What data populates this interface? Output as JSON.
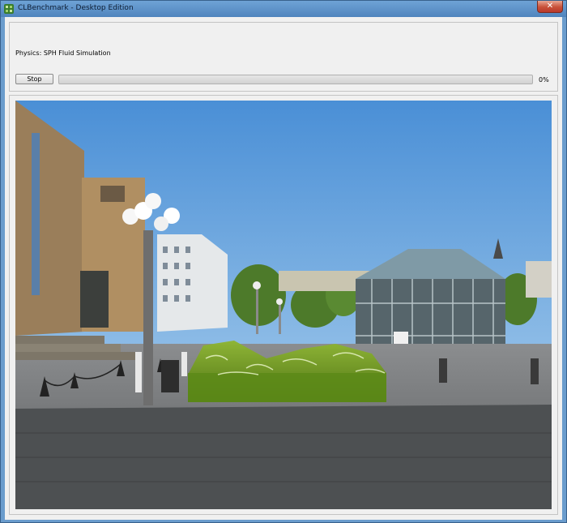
{
  "window": {
    "title": "CLBenchmark - Desktop Edition",
    "close_symbol": "✕"
  },
  "benchmark": {
    "status_label": "Physics: SPH Fluid Simulation",
    "stop_label": "Stop",
    "progress_fraction": 0,
    "progress_text": "0%",
    "progress_color": "#06b025"
  },
  "scene": {
    "description_icon": "fluid-render-icon",
    "fluid_color": "#6f9a22"
  }
}
